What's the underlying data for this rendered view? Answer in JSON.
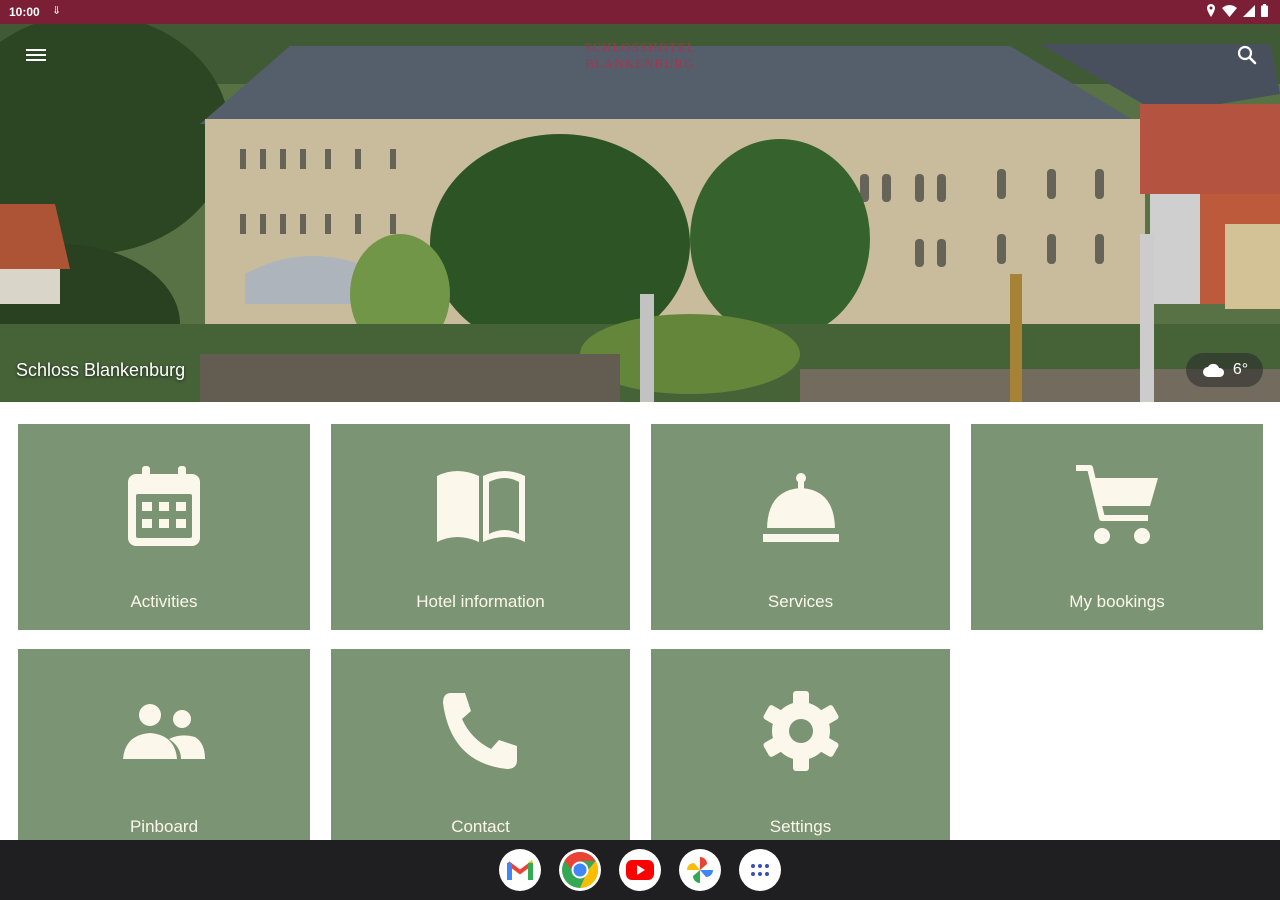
{
  "status_bar": {
    "time": "10:00",
    "note_icon": "download-icon",
    "icons": [
      "location-icon",
      "wifi-icon",
      "signal-icon",
      "battery-icon"
    ]
  },
  "header": {
    "logo_line1": "SCHLOSSHOTEL",
    "logo_line2": "BLANKENBURG",
    "menu_icon": "hamburger-menu-icon",
    "search_icon": "search-icon"
  },
  "hero": {
    "hotel_name": "Schloss Blankenburg",
    "weather_icon": "cloud-icon",
    "temperature": "6°"
  },
  "tiles": [
    {
      "label": "Activities",
      "icon": "calendar-icon"
    },
    {
      "label": "Hotel information",
      "icon": "book-icon"
    },
    {
      "label": "Services",
      "icon": "service-bell-icon"
    },
    {
      "label": "My bookings",
      "icon": "shopping-cart-icon"
    },
    {
      "label": "Pinboard",
      "icon": "people-icon"
    },
    {
      "label": "Contact",
      "icon": "phone-icon"
    },
    {
      "label": "Settings",
      "icon": "gear-icon"
    }
  ],
  "taskbar": {
    "apps": [
      "gmail-icon",
      "chrome-icon",
      "youtube-icon",
      "photos-icon",
      "app-drawer-icon"
    ]
  },
  "colors": {
    "status_bar": "#7a1f35",
    "tile": "#7b9473",
    "tile_text": "#fbf7ea",
    "taskbar": "#1f1f22",
    "logo": "#a8334d"
  }
}
